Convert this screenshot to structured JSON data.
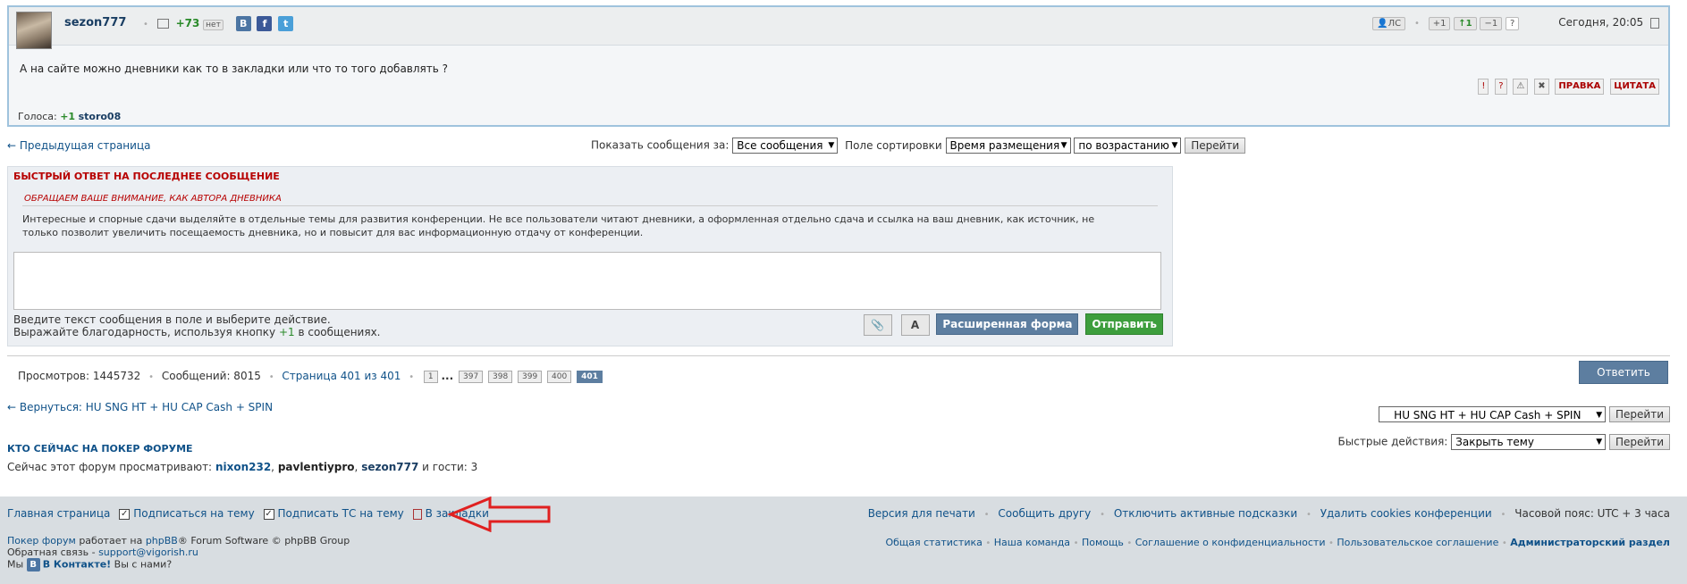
{
  "post": {
    "author": "sezon777",
    "rep_value": "+73",
    "rep_label": "нет",
    "pm_label": "ЛС",
    "vote_plus": "+1",
    "vote_up": "↑1",
    "vote_minus": "−1",
    "help_label": "?",
    "date": "Сегодня, 20:05",
    "body": "А на сайте можно дневники как то в закладки или что то того добавлять ?",
    "edit_label": "ПРАВКА",
    "quote_label": "ЦИТАТА",
    "votes_label": "Голоса:",
    "votes_value": "+1",
    "votes_user": "storo08"
  },
  "nav": {
    "prev_page": "← Предыдущая страница",
    "show_label": "Показать сообщения за:",
    "show_value": "Все сообщения",
    "sort_label": "Поле сортировки",
    "sort_value": "Время размещения",
    "order_value": "по возрастанию",
    "go_label": "Перейти"
  },
  "quick_reply": {
    "title": "БЫСТРЫЙ ОТВЕТ НА ПОСЛЕДНЕЕ СООБЩЕНИЕ",
    "notice_title": "ОБРАЩАЕМ ВАШЕ ВНИМАНИЕ, КАК АВТОРА ДНЕВНИКА",
    "notice_text": "Интересные и спорные сдачи выделяйте в отдельные темы для развития конференции. Не все пользователи читают дневники, а оформленная отдельно сдача и ссылка на ваш дневник, как источник, не только позволит увеличить посещаемость дневника, но и повысит для вас информационную отдачу от конференции.",
    "hint1": "Введите текст сообщения в поле и выберите действие.",
    "hint2_a": "Выражайте благодарность, используя кнопку ",
    "hint2_b": "+1",
    "hint2_c": " в сообщениях.",
    "font_btn": "A",
    "advanced_label": "Расширенная форма",
    "send_label": "Отправить"
  },
  "stats": {
    "views": "Просмотров: 1445732",
    "posts": "Сообщений: 8015",
    "page": "Страница 401 из 401",
    "pages": [
      "1",
      "...",
      "397",
      "398",
      "399",
      "400",
      "401"
    ],
    "reply_label": "Ответить"
  },
  "back": {
    "link": "← Вернуться: HU SNG HT + HU CAP Cash + SPIN",
    "jump_value": "HU SNG HT + HU CAP Cash + SPIN",
    "go_label": "Перейти",
    "quick_label": "Быстрые действия:",
    "quick_value": "Закрыть тему"
  },
  "online": {
    "title": "КТО СЕЙЧАС НА ПОКЕР ФОРУМЕ",
    "text": "Сейчас этот форум просматривают:",
    "users": [
      "nixon232",
      "pavlentiypro",
      "sezon777"
    ],
    "guests": "и гости: 3"
  },
  "footer": {
    "home": "Главная страница",
    "subscribe": "Подписаться на тему",
    "subscribe_ts": "Подписать ТС на тему",
    "bookmarks": "В закладки",
    "print": "Версия для печати",
    "tell": "Сообщить другу",
    "hints": "Отключить активные подсказки",
    "cookies": "Удалить cookies конференции",
    "timezone": "Часовой пояс: UTC + 3 часа",
    "powered_a": "Покер форум",
    "powered_b": " работает на ",
    "powered_c": "phpBB",
    "powered_d": "® Forum Software © phpBB Group",
    "feedback_a": "Обратная связь - ",
    "feedback_b": "support@vigorish.ru",
    "we_a": "Мы ",
    "we_vk": "В Контакте!",
    "we_b": " Вы с нами?",
    "stats_link": "Общая статистика",
    "team": "Наша команда",
    "help": "Помощь",
    "privacy": "Соглашение о конфиденциальности",
    "terms": "Пользовательское соглашение",
    "admin": "Администраторский раздел"
  },
  "colors": {
    "accent": "#105289",
    "alert": "#b70000",
    "green": "#3d9e3d",
    "blue_btn": "#5d7ea0"
  }
}
